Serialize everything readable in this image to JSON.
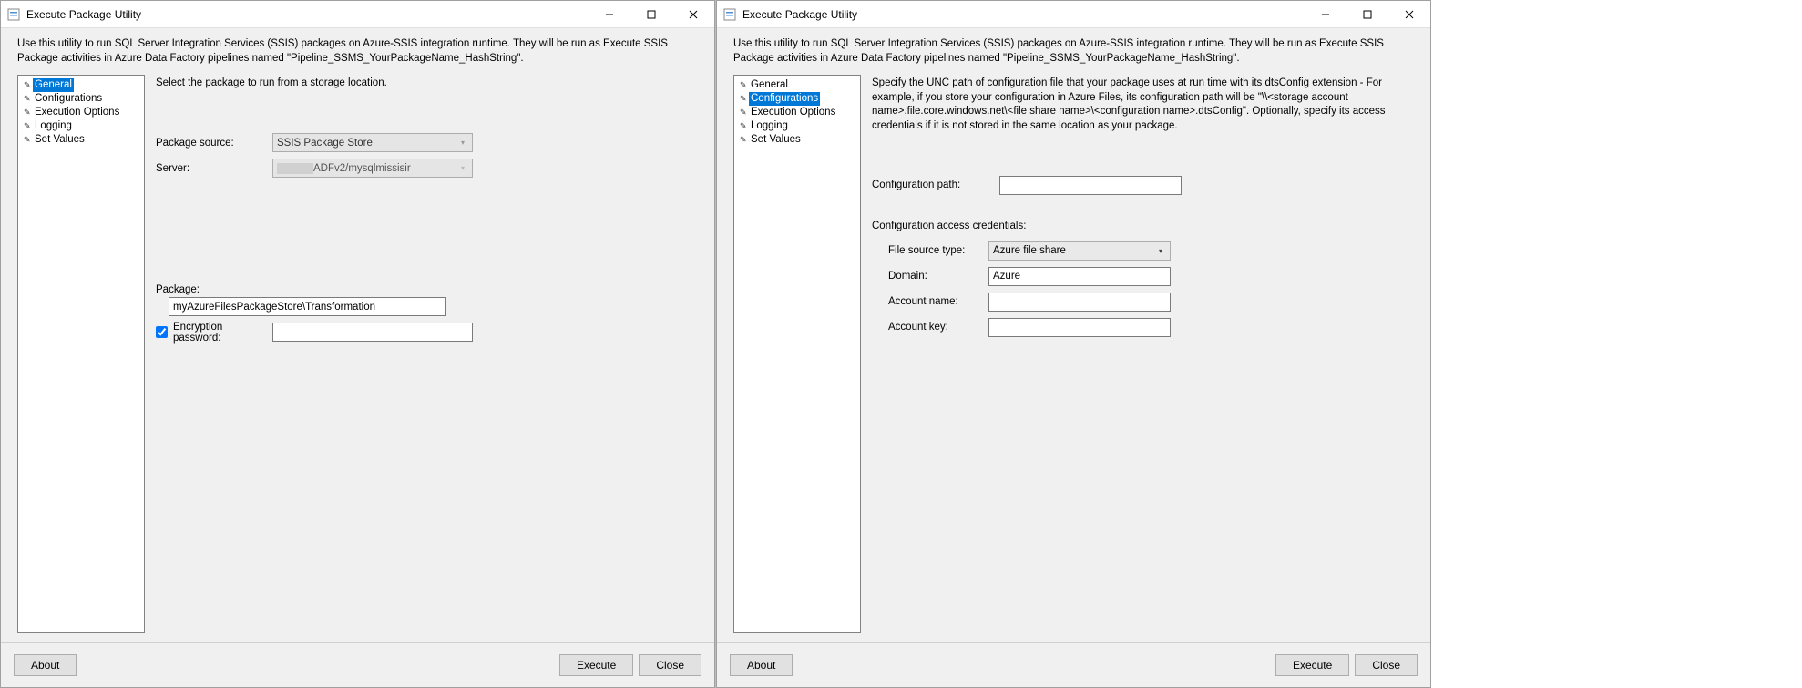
{
  "common": {
    "title": "Execute Package Utility",
    "intro": "Use this utility to run SQL Server Integration Services (SSIS) packages on Azure-SSIS integration runtime. They will be run as Execute SSIS Package activities in Azure Data Factory pipelines named \"Pipeline_SSMS_YourPackageName_HashString\".",
    "nav": {
      "general": "General",
      "configurations": "Configurations",
      "execution_options": "Execution Options",
      "logging": "Logging",
      "set_values": "Set Values"
    },
    "buttons": {
      "about": "About",
      "execute": "Execute",
      "close": "Close"
    }
  },
  "left": {
    "desc": "Select the package to run from a storage location.",
    "labels": {
      "package_source": "Package source:",
      "server": "Server:",
      "package": "Package:",
      "encryption_password": "Encryption password:"
    },
    "values": {
      "package_source": "SSIS Package Store",
      "server_suffix": "ADFv2/mysqlmissisir",
      "package": "myAzureFilesPackageStore\\Transformation",
      "encryption_password": ""
    }
  },
  "right": {
    "desc": "Specify the UNC path of configuration file that your package uses at run time with its dtsConfig extension - For example, if you store your configuration in Azure Files, its configuration path will be \"\\\\<storage account name>.file.core.windows.net\\<file share name>\\<configuration name>.dtsConfig\".  Optionally, specify its access credentials if it is not stored in the same location as your package.",
    "labels": {
      "config_path": "Configuration path:",
      "creds_header": "Configuration access credentials:",
      "file_source_type": "File source type:",
      "domain": "Domain:",
      "account_name": "Account name:",
      "account_key": "Account key:"
    },
    "values": {
      "config_path": "",
      "file_source_type": "Azure file share",
      "domain": "Azure",
      "account_name": "",
      "account_key": ""
    }
  }
}
